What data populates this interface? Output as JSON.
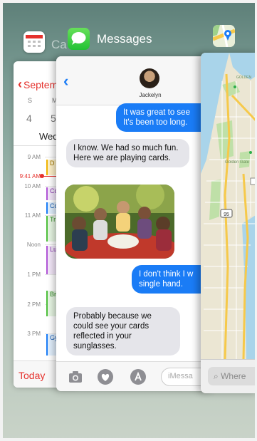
{
  "switcher": {
    "calendar": {
      "app_label": "Ca",
      "back_label": "Septem",
      "weekdays": [
        "S",
        "M"
      ],
      "dates": [
        "4",
        "5"
      ],
      "day_title": "Wed",
      "times": [
        "9 AM",
        "9:41 AM",
        "10 AM",
        "11 AM",
        "Noon",
        "1 PM",
        "2 PM",
        "3 PM"
      ],
      "events": [
        "D",
        "Co",
        "Co",
        "Tr",
        "Lu",
        "Br",
        "Gy"
      ],
      "today_label": "Today",
      "accent": "#e5322d"
    },
    "messages": {
      "app_label": "Messages",
      "contact_name": "Jackelyn",
      "bubbles": [
        {
          "text": "It was great to see\nIt's been too long.",
          "dir": "out"
        },
        {
          "text": "I know. We had so much fun. Here we are playing cards.",
          "dir": "in"
        },
        {
          "text": "I don't think I w\nsingle hand.",
          "dir": "out"
        },
        {
          "text": "Probably because we could see your cards reflected in your sunglasses.",
          "dir": "in"
        }
      ],
      "input_placeholder": "iMessa",
      "accent": "#1a7cf6"
    },
    "maps": {
      "search_placeholder": "Where",
      "map_labels": [
        "GOLDEN",
        "Golden Gate",
        "95"
      ]
    }
  }
}
